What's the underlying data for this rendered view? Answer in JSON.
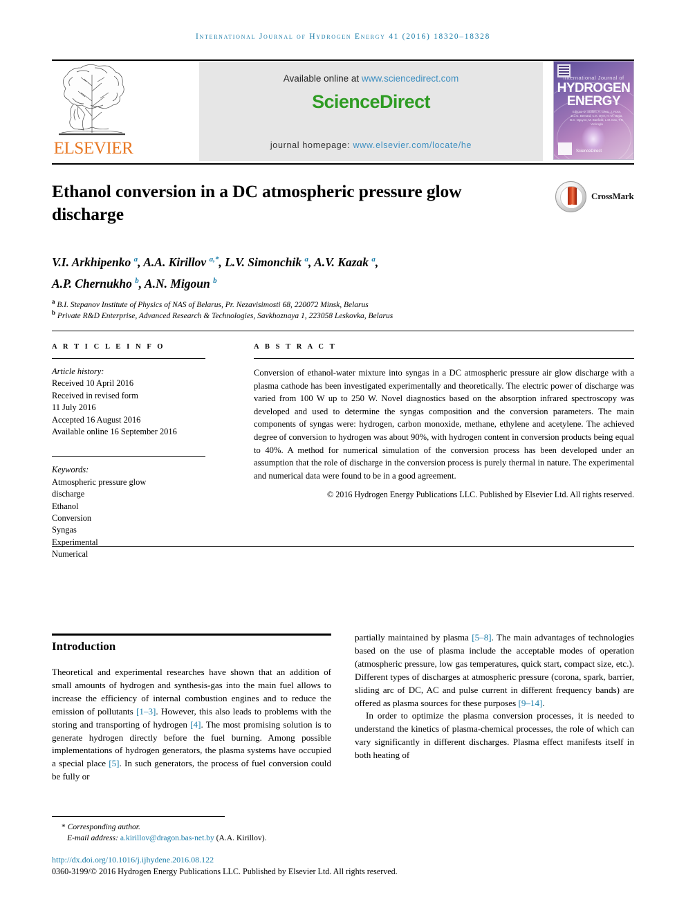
{
  "running_head": "International Journal of Hydrogen Energy 41 (2016) 18320–18328",
  "masthead": {
    "publisher_name": "ELSEVIER",
    "available_online_label": "Available online at ",
    "sciencedirect_url": "www.sciencedirect.com",
    "sciencedirect_logo_part1": "Science",
    "sciencedirect_logo_part2": "Direct",
    "journal_homepage_label": "journal homepage: ",
    "journal_homepage_url": "www.elsevier.com/locate/he",
    "cover": {
      "line1": "International Journal of",
      "line2": "HYDROGEN",
      "line3": "ENERGY",
      "editors": "Editors: D. Stolten, A. Chen, J. Ross, D.J.G. Bernard, C.K. Dyer, H.-M. Ueda, B.C. Nguyen, M. Banfield, L.M. Das, T.N. Veziroglu",
      "sciencedirect": "ScienceDirect"
    }
  },
  "article": {
    "title": "Ethanol conversion in a DC atmospheric pressure glow discharge",
    "crossmark_label": "CrossMark",
    "authors_line1": "V.I. Arkhipenko a, A.A. Kirillov a,*, L.V. Simonchik a, A.V. Kazak a,",
    "authors_line2": "A.P. Chernukho b, A.N. Migoun b",
    "affiliation_a": "B.I. Stepanov Institute of Physics of NAS of Belarus, Pr. Nezavisimosti 68, 220072 Minsk, Belarus",
    "affiliation_b": "Private R&D Enterprise, Advanced Research & Technologies, Savkhoznaya 1, 223058 Leskovka, Belarus"
  },
  "article_info": {
    "section_label": "A R T I C L E   I N F O",
    "history_label": "Article history:",
    "received": "Received 10 April 2016",
    "revised_label": "Received in revised form",
    "revised_date": "11 July 2016",
    "accepted": "Accepted 16 August 2016",
    "available_online": "Available online 16 September 2016",
    "keywords_label": "Keywords:",
    "keywords": [
      "Atmospheric pressure glow",
      "discharge",
      "Ethanol",
      "Conversion",
      "Syngas",
      "Experimental",
      "Numerical"
    ]
  },
  "abstract": {
    "section_label": "A B S T R A C T",
    "text": "Conversion of ethanol-water mixture into syngas in a DC atmospheric pressure air glow discharge with a plasma cathode has been investigated experimentally and theoretically. The electric power of discharge was varied from 100 W up to 250 W. Novel diagnostics based on the absorption infrared spectroscopy was developed and used to determine the syngas composition and the conversion parameters. The main components of syngas were: hydrogen, carbon monoxide, methane, ethylene and acetylene. The achieved degree of conversion to hydrogen was about 90%, with hydrogen content in conversion products being equal to 40%. A method for numerical simulation of the conversion process has been developed under an assumption that the role of discharge in the conversion process is purely thermal in nature. The experimental and numerical data were found to be in a good agreement.",
    "copyright": "© 2016 Hydrogen Energy Publications LLC. Published by Elsevier Ltd. All rights reserved."
  },
  "introduction": {
    "heading": "Introduction",
    "left_para1_a": "Theoretical and experimental researches have shown that an addition of small amounts of hydrogen and synthesis-gas into the main fuel allows to increase the efficiency of internal combustion engines and to reduce the emission of pollutants ",
    "left_ref1": "[1–3]",
    "left_para1_b": ". However, this also leads to problems with the storing and transporting of hydrogen ",
    "left_ref2": "[4]",
    "left_para1_c": ". The most promising solution is to generate hydrogen directly before the fuel burning. Among possible implementations of hydrogen generators, the plasma systems have occupied a special place ",
    "left_ref3": "[5]",
    "left_para1_d": ". In such generators, the process of fuel conversion could be fully or",
    "right_para1_a": "partially maintained by plasma ",
    "right_ref1": "[5–8]",
    "right_para1_b": ". The main advantages of technologies based on the use of plasma include the acceptable modes of operation (atmospheric pressure, low gas temperatures, quick start, compact size, etc.). Different types of discharges at atmospheric pressure (corona, spark, barrier, sliding arc of DC, AC and pulse current in different frequency bands) are offered as plasma sources for these purposes ",
    "right_ref2": "[9–14]",
    "right_para1_c": ".",
    "right_para2": "In order to optimize the plasma conversion processes, it is needed to understand the kinetics of plasma-chemical processes, the role of which can vary significantly in different discharges. Plasma effect manifests itself in both heating of"
  },
  "footer": {
    "corresponding_marker": "*",
    "corresponding_label": "Corresponding author.",
    "email_label": "E-mail address: ",
    "email": "a.kirillov@dragon.bas-net.by",
    "email_owner": " (A.A. Kirillov).",
    "doi": "http://dx.doi.org/10.1016/j.ijhydene.2016.08.122",
    "issn_line": "0360-3199/© 2016 Hydrogen Energy Publications LLC. Published by Elsevier Ltd. All rights reserved."
  },
  "colors": {
    "link_blue": "#1a7ca8",
    "elsevier_orange": "#e87722",
    "sciencedirect_green": "#2f9c24",
    "banner_gray": "#e6e6e6"
  }
}
